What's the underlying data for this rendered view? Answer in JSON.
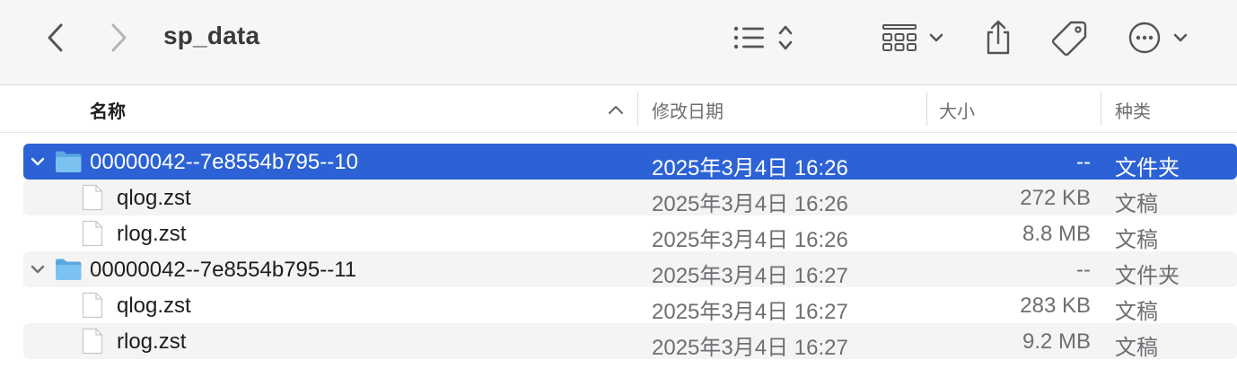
{
  "toolbar": {
    "title": "sp_data",
    "icons": [
      "back-icon",
      "forward-icon",
      "list-view-icon",
      "group-icon",
      "share-icon",
      "tag-icon",
      "more-icon"
    ]
  },
  "columns": {
    "name": "名称",
    "date": "修改日期",
    "size": "大小",
    "kind": "种类"
  },
  "colors": {
    "selection": "#2c62d6",
    "folder": "#6fb8ec"
  },
  "rows": [
    {
      "type": "folder",
      "expanded": true,
      "selected": true,
      "name": "00000042--7e8554b795--10",
      "date": "2025年3月4日 16:26",
      "size": "--",
      "kind": "文件夹"
    },
    {
      "type": "file",
      "name": "qlog.zst",
      "date": "2025年3月4日 16:26",
      "size": "272 KB",
      "kind": "文稿"
    },
    {
      "type": "file",
      "name": "rlog.zst",
      "date": "2025年3月4日 16:26",
      "size": "8.8 MB",
      "kind": "文稿"
    },
    {
      "type": "folder",
      "expanded": true,
      "selected": false,
      "name": "00000042--7e8554b795--11",
      "date": "2025年3月4日 16:27",
      "size": "--",
      "kind": "文件夹"
    },
    {
      "type": "file",
      "name": "qlog.zst",
      "date": "2025年3月4日 16:27",
      "size": "283 KB",
      "kind": "文稿"
    },
    {
      "type": "file",
      "name": "rlog.zst",
      "date": "2025年3月4日 16:27",
      "size": "9.2 MB",
      "kind": "文稿"
    }
  ]
}
